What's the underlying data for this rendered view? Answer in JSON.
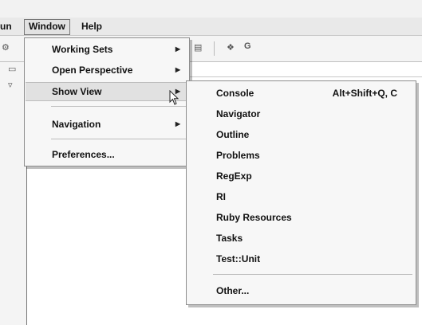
{
  "menubar": {
    "items": [
      "un",
      "Window",
      "Help"
    ]
  },
  "window_menu": {
    "items": [
      {
        "label": "Working Sets",
        "submenu": true
      },
      {
        "label": "Open Perspective",
        "submenu": true
      },
      {
        "label": "Show View",
        "submenu": true,
        "highlighted": true
      },
      {
        "label": "Navigation",
        "submenu": true
      },
      {
        "label": "Preferences...",
        "submenu": false
      }
    ]
  },
  "show_view_menu": {
    "items": [
      {
        "label": "Console",
        "shortcut": "Alt+Shift+Q, C"
      },
      {
        "label": "Navigator"
      },
      {
        "label": "Outline"
      },
      {
        "label": "Problems"
      },
      {
        "label": "RegExp"
      },
      {
        "label": "RI"
      },
      {
        "label": "Ruby Resources"
      },
      {
        "label": "Tasks"
      },
      {
        "label": "Test::Unit"
      },
      {
        "label": "Other..."
      }
    ]
  },
  "icons": {
    "submenu_arrow": "triangle-right-icon",
    "toolbar": [
      "run-icon",
      "save-icon",
      "new-class-icon",
      "refresh-icon"
    ],
    "panel": [
      "minimize-icon",
      "view-menu-icon"
    ]
  },
  "colors": {
    "menu_bg": "#f7f7f7",
    "highlight_bg": "#e1e1e1",
    "menubar_bg": "#e9e9e9"
  }
}
